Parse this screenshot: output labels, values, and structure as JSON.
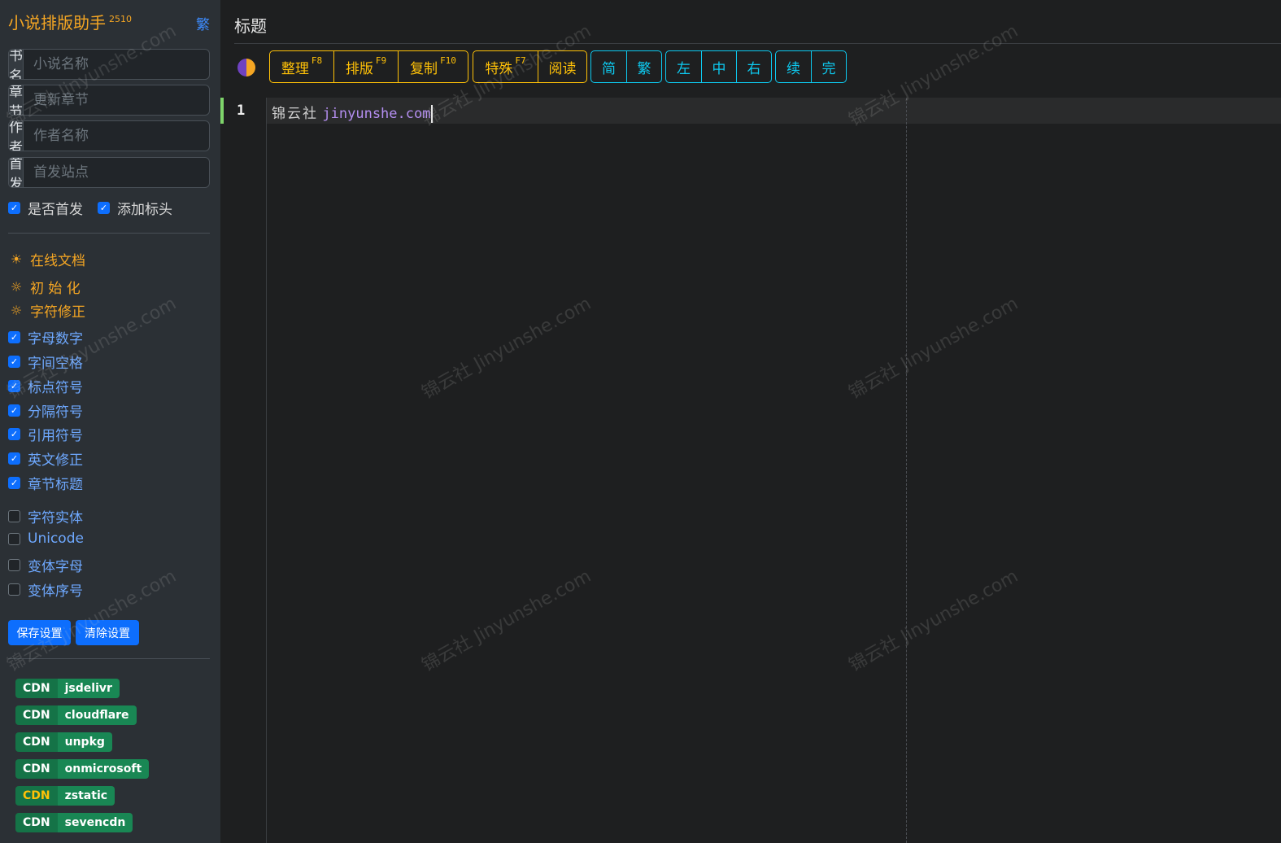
{
  "sidebar": {
    "app_title": "小说排版助手",
    "version": "2510",
    "lang_toggle": "繁",
    "fields": [
      {
        "label": "书名",
        "placeholder": "小说名称",
        "value": ""
      },
      {
        "label": "章节",
        "placeholder": "更新章节",
        "value": ""
      },
      {
        "label": "作者",
        "placeholder": "作者名称",
        "value": ""
      },
      {
        "label": "首发",
        "placeholder": "首发站点",
        "value": ""
      }
    ],
    "header_checks": [
      {
        "label": "是否首发",
        "checked": true
      },
      {
        "label": "添加标头",
        "checked": true
      }
    ],
    "actions": [
      {
        "label": "在线文档",
        "icon": "sun-filled-icon"
      },
      {
        "label": "初 始 化",
        "icon": "sun-icon"
      },
      {
        "label": "字符修正",
        "icon": "sun-icon"
      }
    ],
    "options_checked": [
      {
        "label": "字母数字",
        "checked": true
      },
      {
        "label": "字间空格",
        "checked": true
      },
      {
        "label": "标点符号",
        "checked": true
      },
      {
        "label": "分隔符号",
        "checked": true
      },
      {
        "label": "引用符号",
        "checked": true
      },
      {
        "label": "英文修正",
        "checked": true
      },
      {
        "label": "章节标题",
        "checked": true
      }
    ],
    "options_unchecked": [
      {
        "label": "字符实体",
        "checked": false
      },
      {
        "label": "Unicode",
        "checked": false
      },
      {
        "label": "变体字母",
        "checked": false
      },
      {
        "label": "变体序号",
        "checked": false
      }
    ],
    "save_button": "保存设置",
    "clear_button": "清除设置",
    "cdn_badges": [
      {
        "key": "CDN",
        "name": "jsdelivr"
      },
      {
        "key": "CDN",
        "name": "cloudflare"
      },
      {
        "key": "CDN",
        "name": "unpkg"
      },
      {
        "key": "CDN",
        "name": "onmicrosoft"
      },
      {
        "key": "CDN",
        "name": "zstatic"
      },
      {
        "key": "CDN",
        "name": "sevencdn"
      }
    ]
  },
  "main": {
    "title": "标题",
    "toolbar": {
      "group1": [
        {
          "label": "整理",
          "key": "F8"
        },
        {
          "label": "排版",
          "key": "F9"
        },
        {
          "label": "复制",
          "key": "F10"
        }
      ],
      "group2": [
        {
          "label": "特殊",
          "key": "F7"
        },
        {
          "label": "阅读",
          "key": ""
        }
      ],
      "group3": [
        {
          "label": "简"
        },
        {
          "label": "繁"
        }
      ],
      "group4": [
        {
          "label": "左"
        },
        {
          "label": "中"
        },
        {
          "label": "右"
        }
      ],
      "group5": [
        {
          "label": "续"
        },
        {
          "label": "完"
        }
      ]
    },
    "editor": {
      "line_number": "1",
      "text_cn": "锦云社",
      "text_url": "jinyunshe.com"
    }
  },
  "watermark": "锦云社 Jinyunshe.com",
  "colors": {
    "accent_orange": "#ffc107",
    "accent_cyan": "#0dcaf0",
    "primary_blue": "#0d6efd",
    "cdn_green": "#198754"
  }
}
